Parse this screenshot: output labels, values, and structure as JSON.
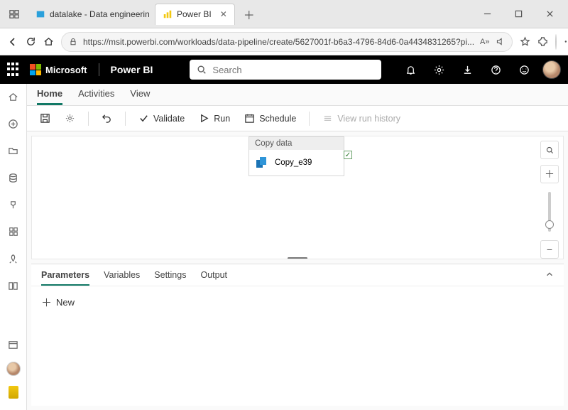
{
  "browser": {
    "tabs": [
      {
        "label": "datalake - Data engineering",
        "active": false
      },
      {
        "label": "Power BI",
        "active": true
      }
    ],
    "url": "https://msit.powerbi.com/workloads/data-pipeline/create/5627001f-b6a3-4796-84d6-0a4434831265?pi...",
    "reader_badge": "A»"
  },
  "header": {
    "brand_ms": "Microsoft",
    "brand_pbi": "Power BI",
    "search_placeholder": "Search"
  },
  "page_tabs": {
    "home": "Home",
    "activities": "Activities",
    "view": "View"
  },
  "toolbar": {
    "validate": "Validate",
    "run": "Run",
    "schedule": "Schedule",
    "view_run_history": "View run history"
  },
  "canvas": {
    "node_title": "Copy data",
    "node_name": "Copy_e39"
  },
  "bottom_panel": {
    "tabs": {
      "parameters": "Parameters",
      "variables": "Variables",
      "settings": "Settings",
      "output": "Output"
    },
    "new": "New"
  }
}
